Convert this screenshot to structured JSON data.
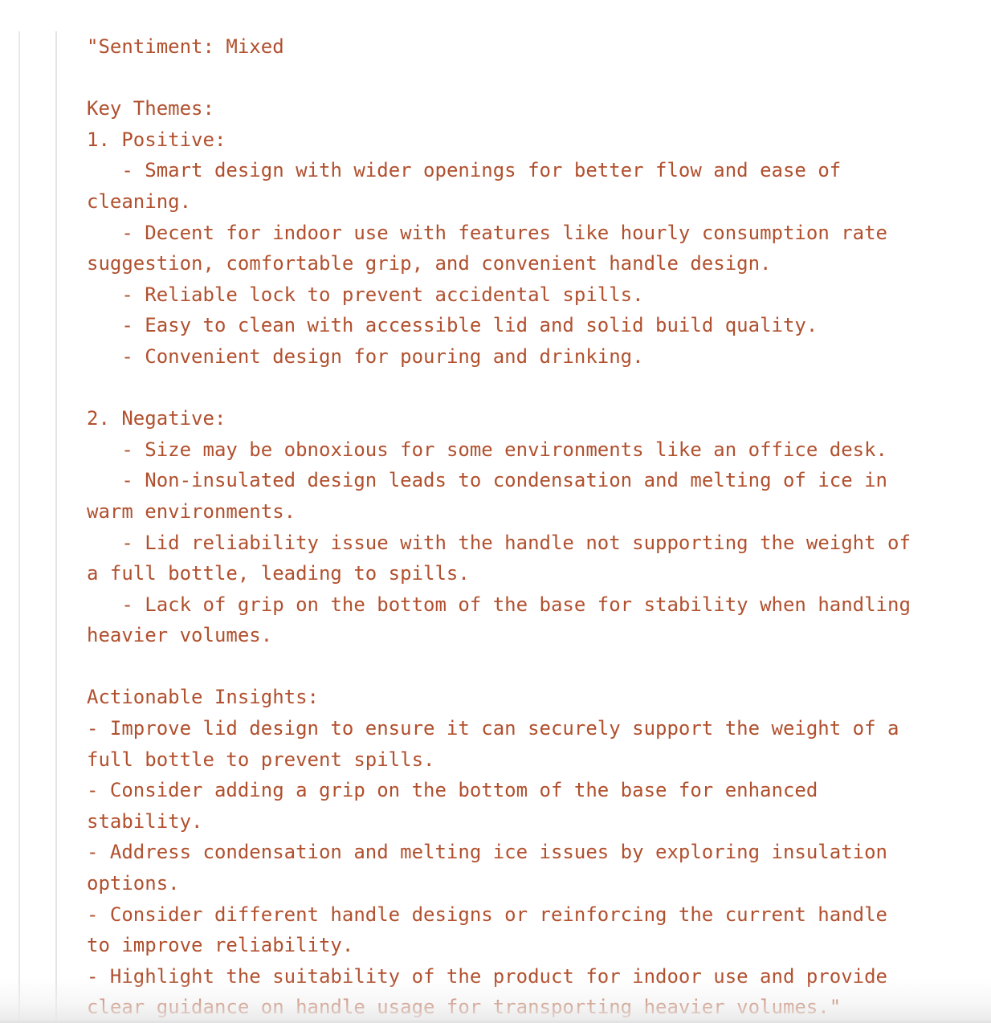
{
  "theme": {
    "background": "#ffffff",
    "text_color": "#b1502e",
    "gutter_color": "#e8e8e8"
  },
  "output": {
    "name": "stream-output",
    "text": "\"Sentiment: Mixed\n\nKey Themes:\n1. Positive:\n   - Smart design with wider openings for better flow and ease of cleaning.\n   - Decent for indoor use with features like hourly consumption rate suggestion, comfortable grip, and convenient handle design.\n   - Reliable lock to prevent accidental spills.\n   - Easy to clean with accessible lid and solid build quality.\n   - Convenient design for pouring and drinking.\n\n2. Negative:\n   - Size may be obnoxious for some environments like an office desk.\n   - Non-insulated design leads to condensation and melting of ice in warm environments.\n   - Lid reliability issue with the handle not supporting the weight of a full bottle, leading to spills.\n   - Lack of grip on the bottom of the base for stability when handling heavier volumes.\n\nActionable Insights:\n- Improve lid design to ensure it can securely support the weight of a full bottle to prevent spills.\n- Consider adding a grip on the bottom of the base for enhanced stability.\n- Address condensation and melting ice issues by exploring insulation options.\n- Consider different handle designs or reinforcing the current handle to improve reliability.\n- Highlight the suitability of the product for indoor use and provide clear guidance on handle usage for transporting heavier volumes.\"",
    "sections": {
      "sentiment_label": "\"Sentiment: Mixed",
      "key_themes_heading": "Key Themes:",
      "positive_heading": "1. Positive:",
      "positive_points": [
        "- Smart design with wider openings for better flow and ease of cleaning.",
        "- Decent for indoor use with features like hourly consumption rate suggestion, comfortable grip, and convenient handle design.",
        "- Reliable lock to prevent accidental spills.",
        "- Easy to clean with accessible lid and solid build quality.",
        "- Convenient design for pouring and drinking."
      ],
      "negative_heading": "2. Negative:",
      "negative_points": [
        "- Size may be obnoxious for some environments like an office desk.",
        "- Non-insulated design leads to condensation and melting of ice in warm environments.",
        "- Lid reliability issue with the handle not supporting the weight of a full bottle, leading to spills.",
        "- Lack of grip on the bottom of the base for stability when handling heavier volumes."
      ],
      "actionable_insights_heading": "Actionable Insights:",
      "actionable_insights": [
        "- Improve lid design to ensure it can securely support the weight of a full bottle to prevent spills.",
        "- Consider adding a grip on the bottom of the base for enhanced stability.",
        "- Address condensation and melting ice issues by exploring insulation options.",
        "- Consider different handle designs or reinforcing the current handle to improve reliability.",
        "- Highlight the suitability of the product for indoor use and provide clear guidance on handle usage for transporting heavier volumes.\""
      ]
    }
  }
}
